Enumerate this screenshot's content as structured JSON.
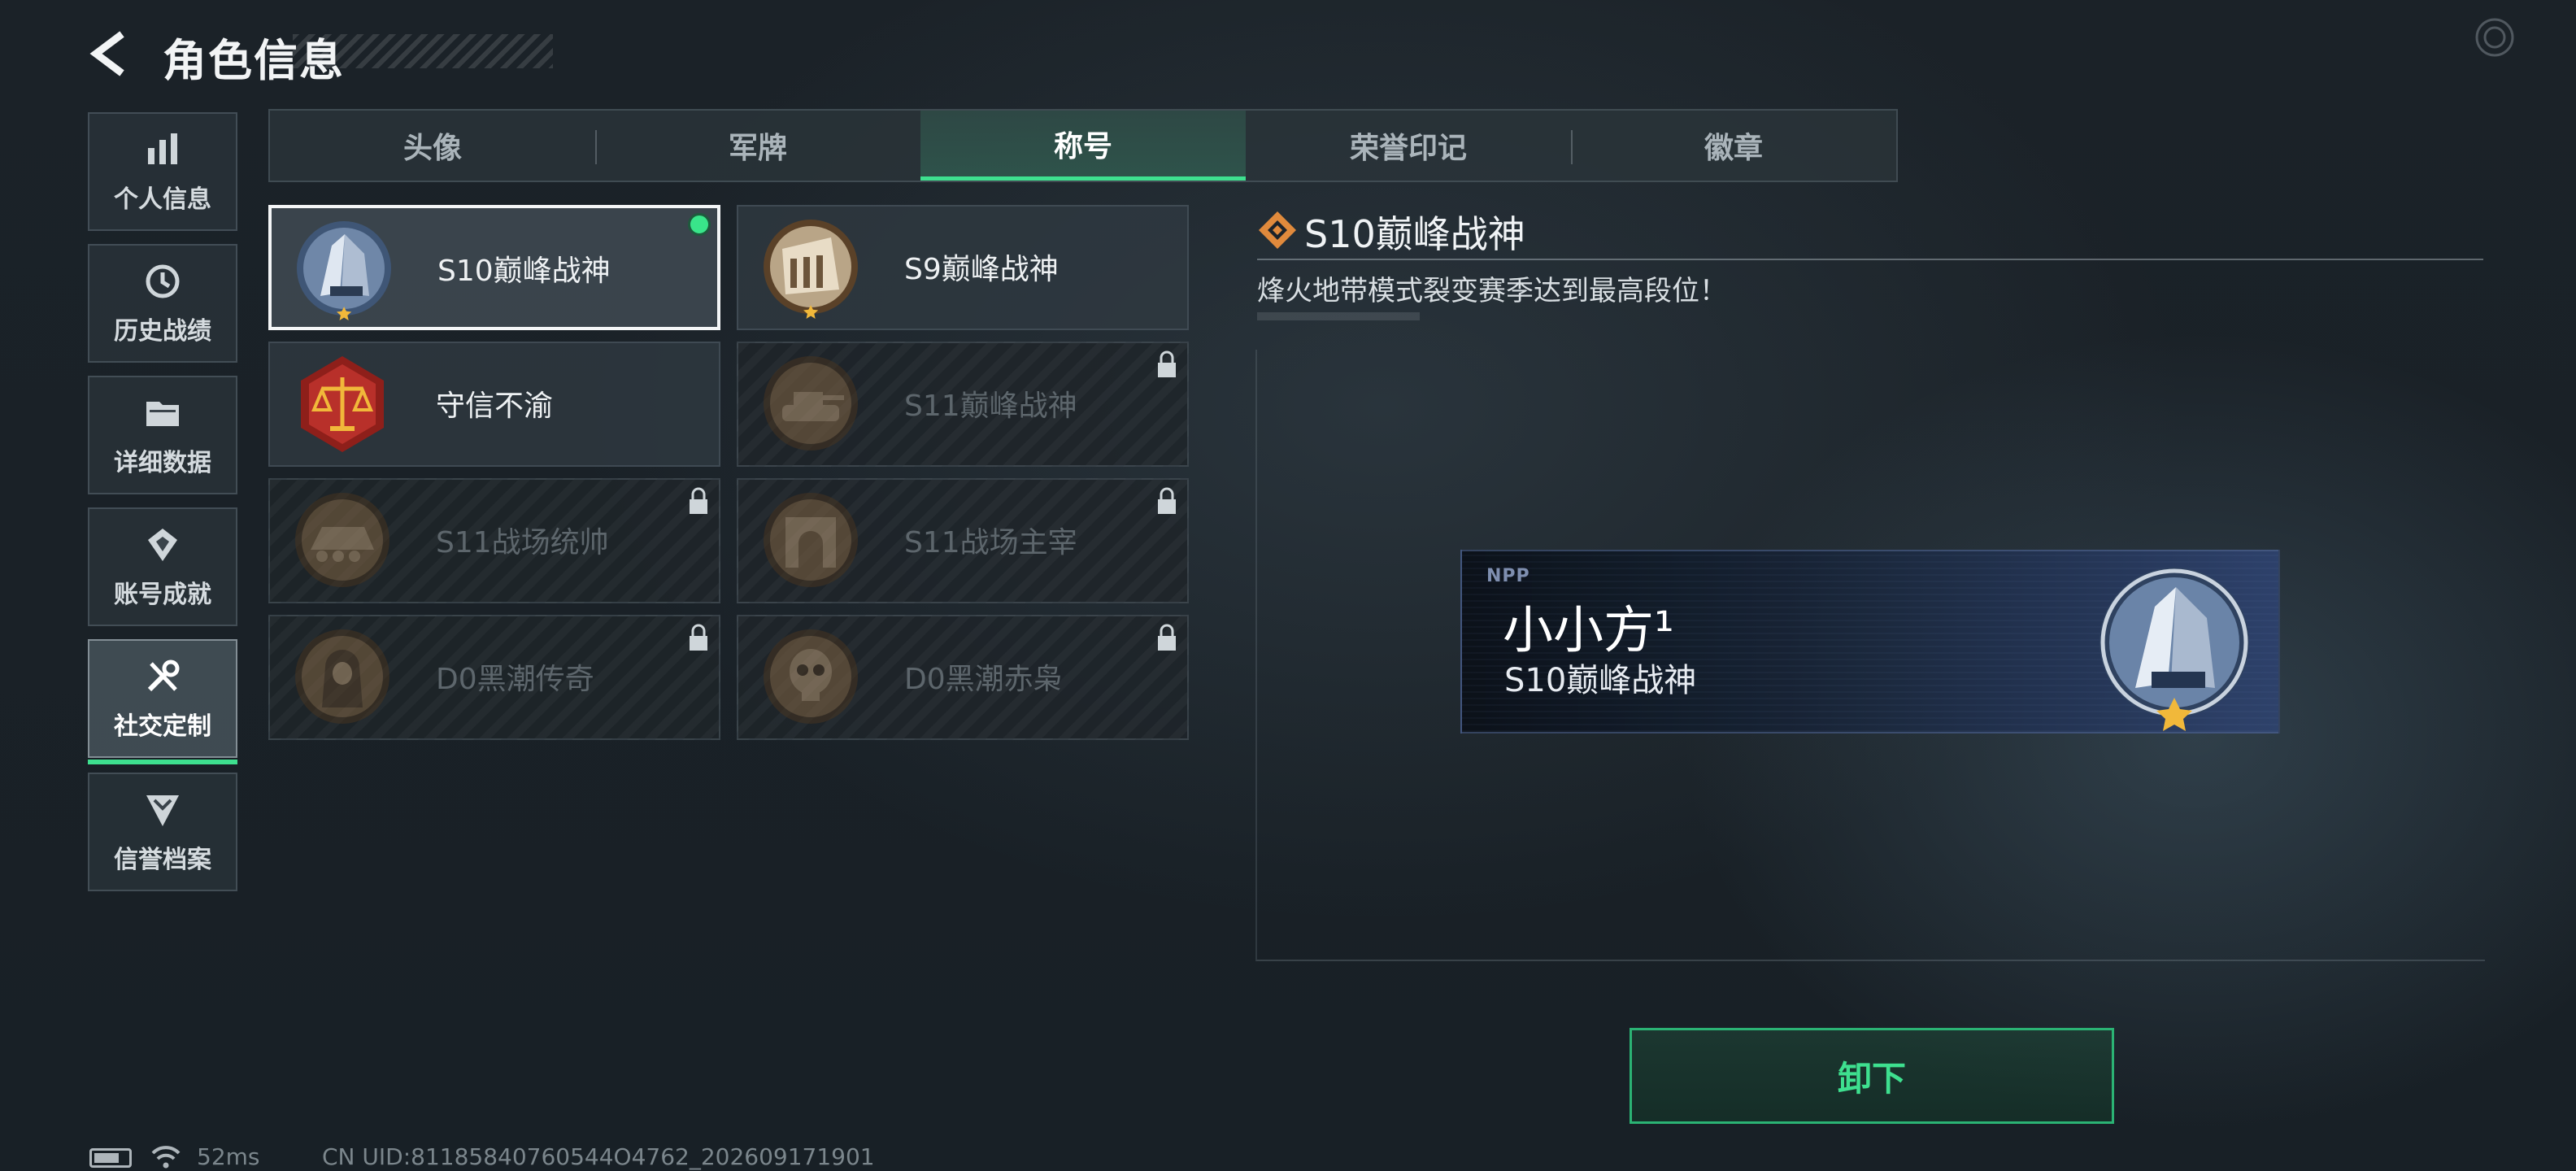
{
  "header": {
    "title": "角色信息"
  },
  "sidebar": {
    "items": [
      {
        "label": "个人信息",
        "icon": "bar-chart-icon"
      },
      {
        "label": "历史战绩",
        "icon": "history-clock-icon"
      },
      {
        "label": "详细数据",
        "icon": "folder-icon"
      },
      {
        "label": "账号成就",
        "icon": "achievement-badge-icon"
      },
      {
        "label": "社交定制",
        "icon": "tools-icon",
        "active": true
      },
      {
        "label": "信誉档案",
        "icon": "shield-chevron-icon"
      }
    ]
  },
  "tabs": [
    {
      "label": "头像"
    },
    {
      "label": "军牌"
    },
    {
      "label": "称号",
      "active": true
    },
    {
      "label": "荣誉印记"
    },
    {
      "label": "徽章"
    }
  ],
  "titles": [
    {
      "name": "S10巅峰战神",
      "selected": true,
      "equipped": true,
      "locked": false
    },
    {
      "name": "S9巅峰战神",
      "locked": false
    },
    {
      "name": "守信不渝",
      "locked": false
    },
    {
      "name": "S11巅峰战神",
      "locked": true
    },
    {
      "name": "S11战场统帅",
      "locked": true
    },
    {
      "name": "S11战场主宰",
      "locked": true
    },
    {
      "name": "D0黑潮传奇",
      "locked": true
    },
    {
      "name": "D0黑潮赤枭",
      "locked": true
    }
  ],
  "detail": {
    "title": "S10巅峰战神",
    "description": "烽火地带模式裂变赛季达到最高段位！"
  },
  "nameplate": {
    "logo": "NPP",
    "player_name": "小小方¹",
    "title": "S10巅峰战神"
  },
  "actions": {
    "unequip_label": "卸下"
  },
  "status": {
    "ping": "52ms",
    "uid": "CN UID:81185840760544O4762_202609171901"
  },
  "colors": {
    "accent_green": "#3ee08f",
    "background": "#1a2127",
    "medal_gold": "#f1b83a",
    "medal_bronze": "#8a6a45"
  }
}
